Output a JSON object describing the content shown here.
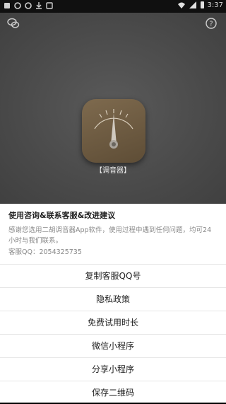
{
  "status_bar": {
    "time": "3:37",
    "icons": [
      "app-notification-icon",
      "app-notification-icon",
      "app-notification-icon",
      "download-icon",
      "app-notification-icon",
      "wifi-icon",
      "signal-icon",
      "battery-icon"
    ]
  },
  "header": {
    "left_icon": "chat-icon",
    "right_icon": "help-icon"
  },
  "app": {
    "label": "【调音器】",
    "logo_icon": "tuner-gauge-icon"
  },
  "sheet": {
    "title": "使用咨询&联系客服&改进建议",
    "description": "感谢您选用二胡调音器App软件，使用过程中遇到任何问题，均可24小时与我们联系。",
    "qq": "客服QQ：2054325735",
    "menu": [
      {
        "label": "复制客服QQ号"
      },
      {
        "label": "隐私政策"
      },
      {
        "label": "免费试用时长"
      },
      {
        "label": "微信小程序"
      },
      {
        "label": "分享小程序"
      },
      {
        "label": "保存二维码"
      }
    ]
  },
  "colors": {
    "sheet_bg": "#ffffff",
    "overlay_bg": "#4a4a4a",
    "logo_wood": "#6e5a40"
  }
}
